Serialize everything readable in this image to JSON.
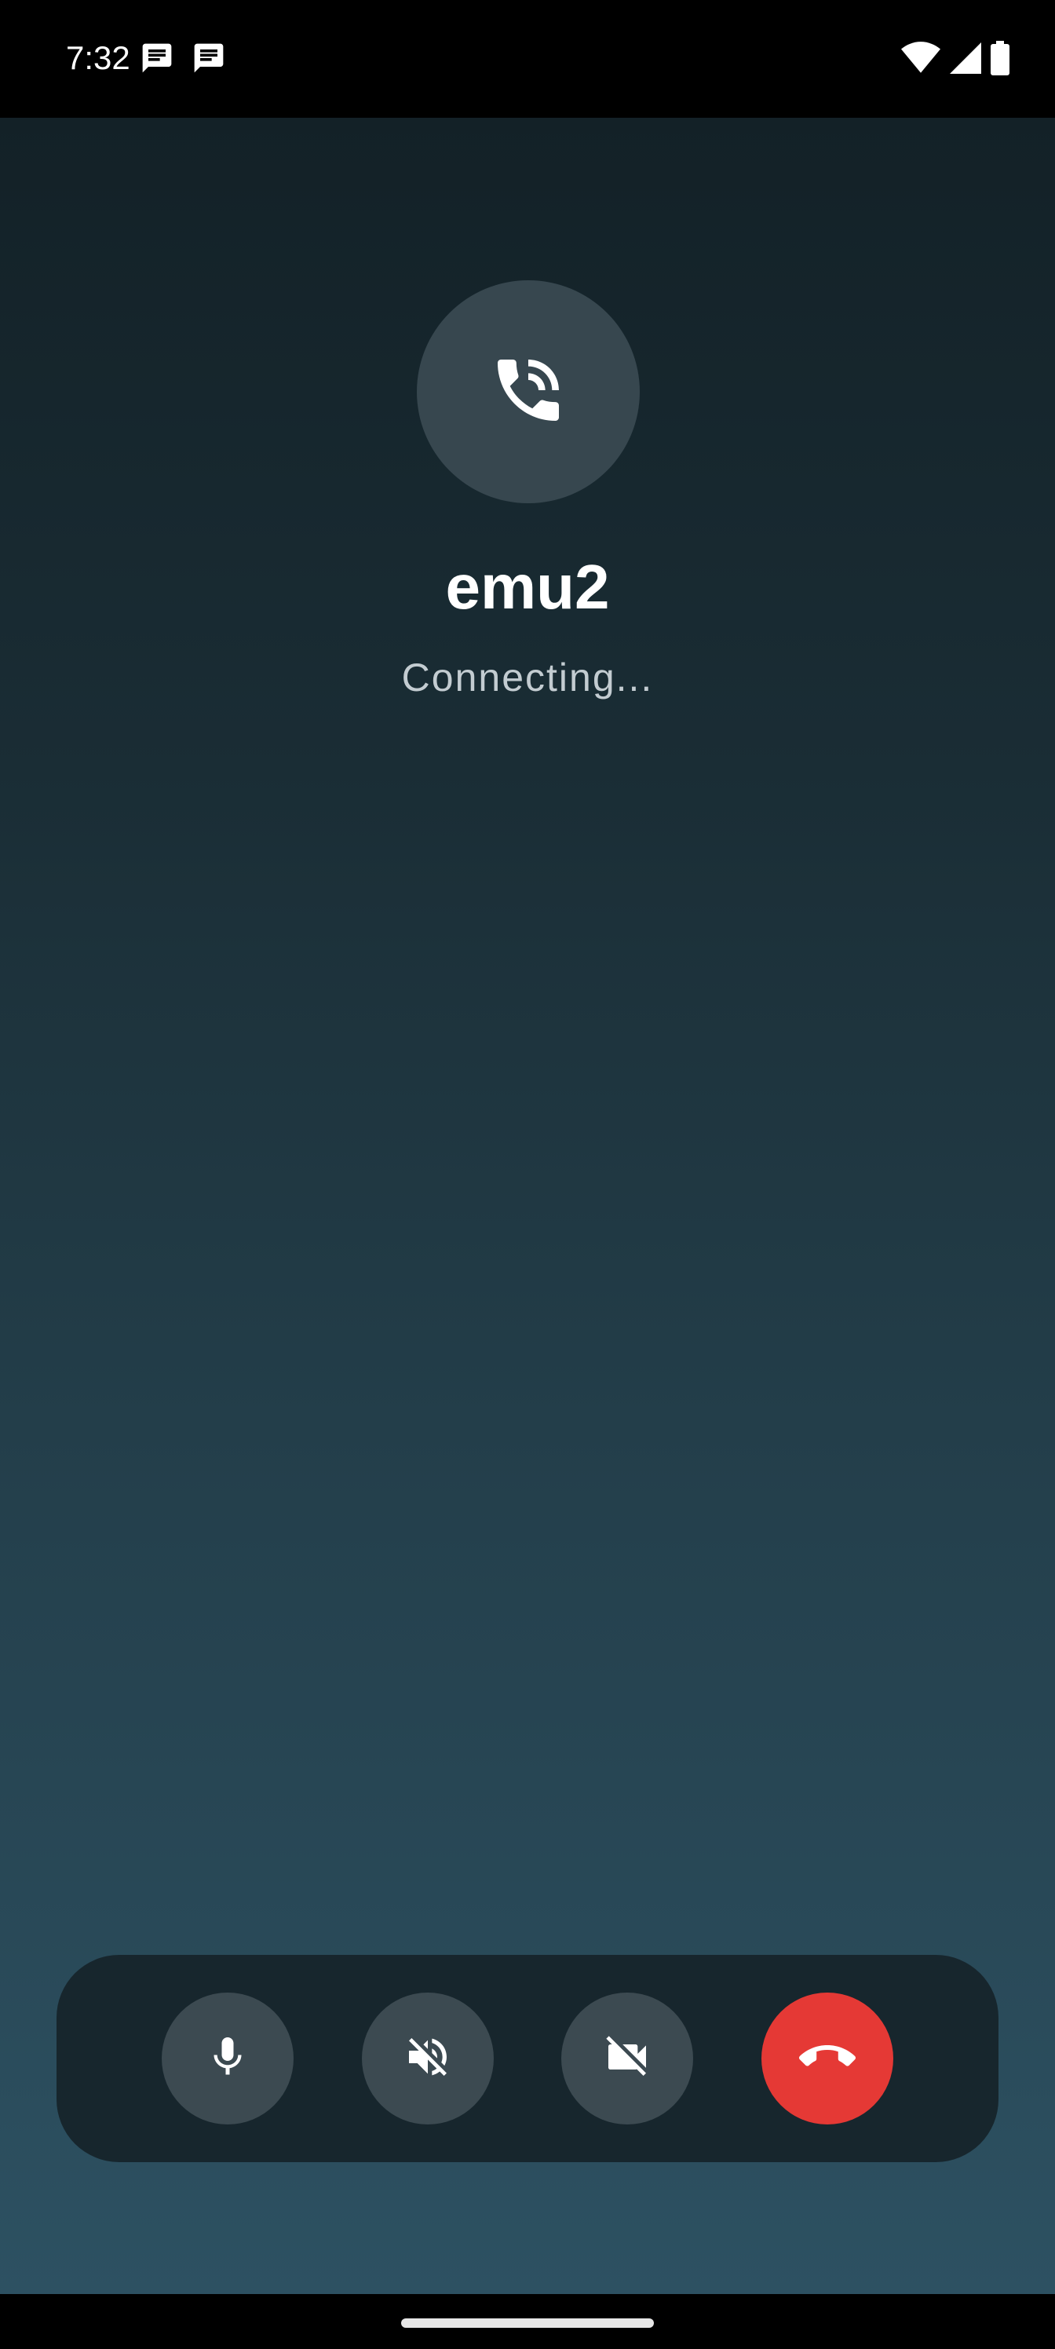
{
  "status_bar": {
    "time": "7:32",
    "left_icons": [
      "message-icon",
      "message-icon"
    ],
    "right_icons": [
      "wifi-icon",
      "cellular-signal-icon",
      "battery-icon"
    ]
  },
  "call": {
    "contact_name": "emu2",
    "status": "Connecting...",
    "avatar_icon": "phone-calling-icon"
  },
  "controls": {
    "buttons": [
      {
        "name": "microphone",
        "icon": "microphone-icon"
      },
      {
        "name": "speaker-muted",
        "icon": "volume-off-icon"
      },
      {
        "name": "video-off",
        "icon": "videocam-off-icon"
      },
      {
        "name": "hang-up",
        "icon": "call-end-icon"
      }
    ]
  },
  "colors": {
    "background_top": "#132127",
    "background_bottom": "#2d5162",
    "control_panel": "#17262d",
    "control_button": "#3c4a51",
    "hangup_button": "#e53935",
    "avatar_bg": "#37474f"
  }
}
